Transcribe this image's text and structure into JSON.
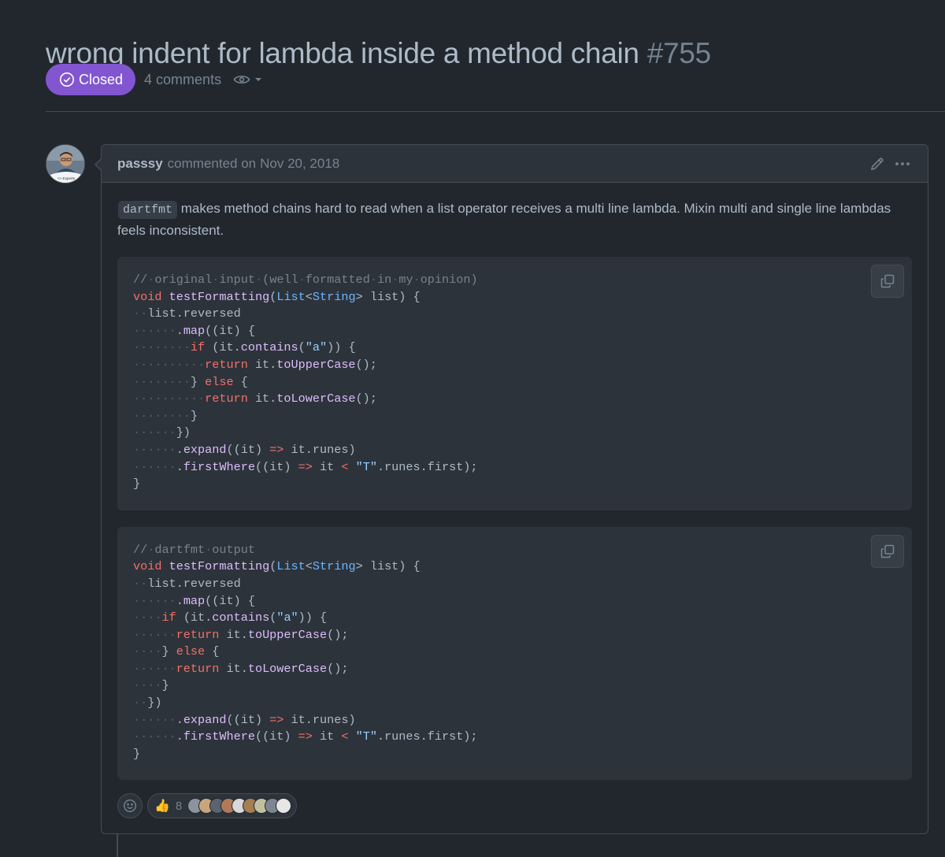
{
  "issue": {
    "title": "wrong indent for lambda inside a method chain",
    "number": "#755",
    "status": "Closed",
    "comments_count": "4 comments"
  },
  "comment": {
    "author": "passsy",
    "action": "commented on",
    "date": "Nov 20, 2018",
    "inline_code": "dartfmt",
    "text": " makes method chains hard to read when a list operator receives a multi line lambda. Mixin multi and single line lambdas feels inconsistent.",
    "code_blocks": [
      {
        "lines": [
          "// original input (well formatted in my opinion)",
          "void testFormatting(List<String> list) {",
          "  list.reversed",
          "      .map((it) {",
          "        if (it.contains(\"a\")) {",
          "          return it.toUpperCase();",
          "        } else {",
          "          return it.toLowerCase();",
          "        }",
          "      })",
          "      .expand((it) => it.runes)",
          "      .firstWhere((it) => it < \"T\".runes.first);",
          "}"
        ]
      },
      {
        "lines": [
          "// dartfmt output",
          "void testFormatting(List<String> list) {",
          "  list.reversed",
          "      .map((it) {",
          "    if (it.contains(\"a\")) {",
          "      return it.toUpperCase();",
          "    } else {",
          "      return it.toLowerCase();",
          "    }",
          "  })",
          "      .expand((it) => it.runes)",
          "      .firstWhere((it) => it < \"T\".runes.first);",
          "}"
        ]
      }
    ],
    "reactions": {
      "emoji": "👍",
      "count": "8",
      "reactor_colors": [
        "#8b949e",
        "#c9a57c",
        "#5a6470",
        "#b07a5a",
        "#d8d8d8",
        "#a67c52",
        "#c0c0a0",
        "#7d8590",
        "#e6e6e6"
      ]
    }
  },
  "icons": {
    "status": "check-circle-icon",
    "watch": "eye-icon",
    "edit": "pencil-icon",
    "more": "kebab-horizontal-icon",
    "copy": "copy-icon",
    "add_reaction": "smiley-icon"
  },
  "colors": {
    "closed_badge": "#8256d0",
    "background": "#22272e"
  }
}
